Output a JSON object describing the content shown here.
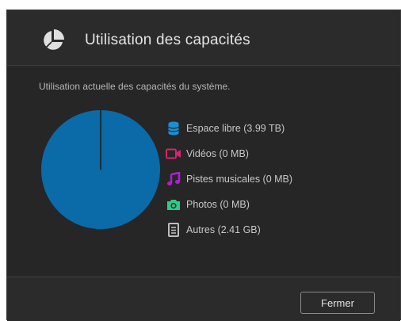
{
  "dialog": {
    "title": "Utilisation des capacités",
    "title_icon": "pie-chart-icon",
    "subtitle": "Utilisation actuelle des capacités du système.",
    "close_label": "Fermer"
  },
  "legend": [
    {
      "label": "Espace libre (3.99 TB)",
      "icon": "storage-icon",
      "color": "#1a8fd6"
    },
    {
      "label": "Vidéos (0 MB)",
      "icon": "video-icon",
      "color": "#d6246e"
    },
    {
      "label": "Pistes musicales (0 MB)",
      "icon": "music-icon",
      "color": "#b01fd6"
    },
    {
      "label": "Photos (0 MB)",
      "icon": "camera-icon",
      "color": "#2fc98a"
    },
    {
      "label": "Autres (2.41 GB)",
      "icon": "document-icon",
      "color": "#bdbdbd"
    }
  ],
  "chart_data": {
    "type": "pie",
    "categories": [
      "Espace libre",
      "Vidéos",
      "Pistes musicales",
      "Photos",
      "Autres"
    ],
    "values": [
      4085.76,
      0,
      0,
      0,
      2.41
    ],
    "units": "GB",
    "colors": [
      "#0b6aa8",
      "#d6246e",
      "#b01fd6",
      "#2fc98a",
      "#1a1a1a"
    ]
  }
}
